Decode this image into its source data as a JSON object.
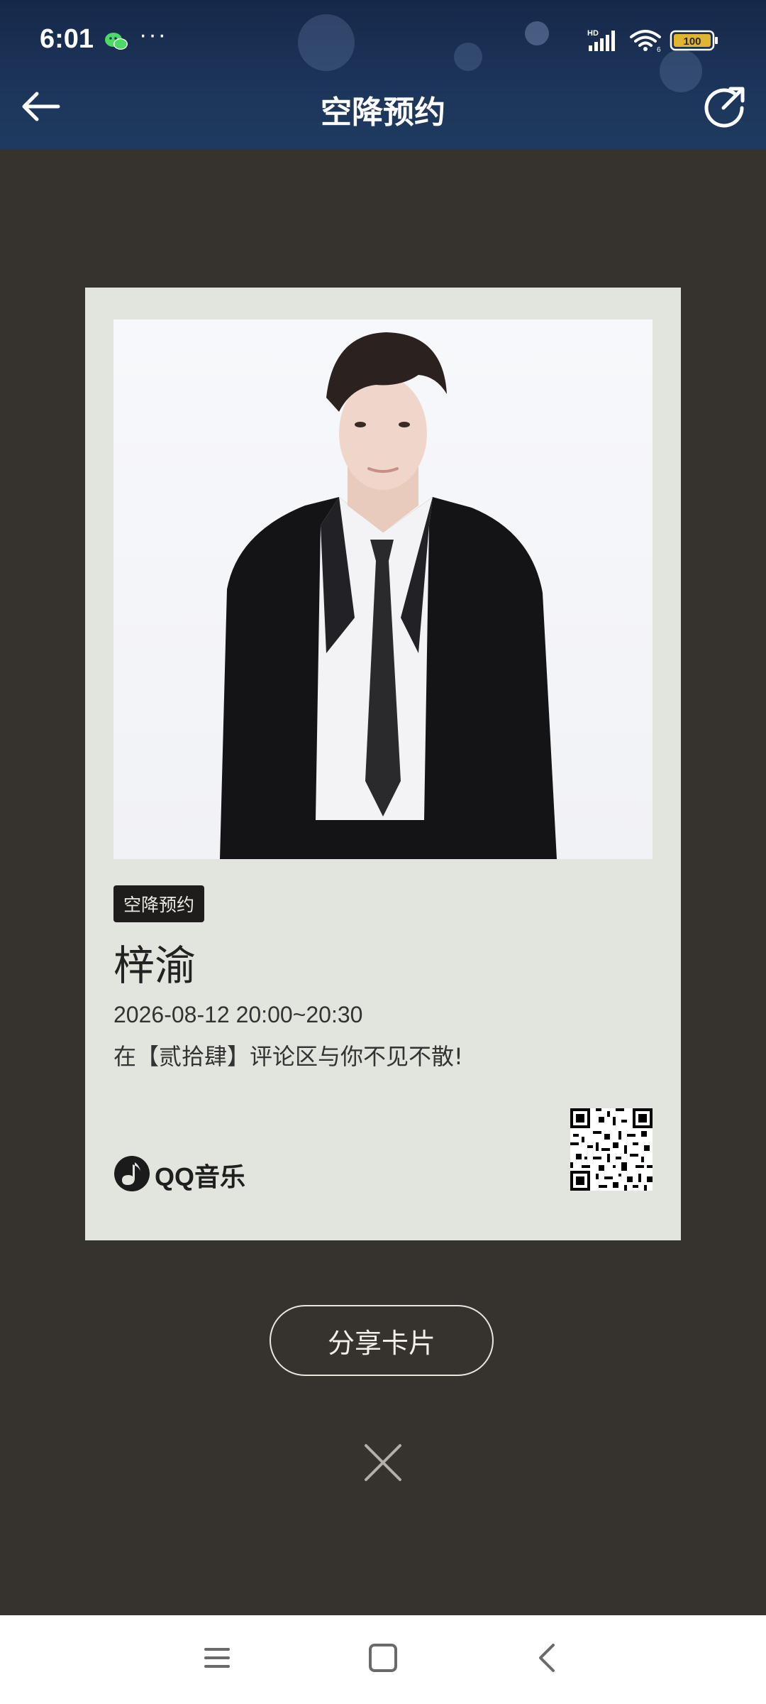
{
  "status_bar": {
    "time": "6:01",
    "more_dots": "···",
    "network_label": "HD",
    "wifi_label": "6",
    "battery": "100"
  },
  "header": {
    "title": "空降预约"
  },
  "card": {
    "tag": "空降预约",
    "artist": "梓渝",
    "datetime": "2026-08-12 20:00~20:30",
    "message": "在【贰拾肆】评论区与你不见不散!",
    "brand": "QQ音乐"
  },
  "actions": {
    "share_label": "分享卡片"
  },
  "colors": {
    "header_bg": "#1d355a",
    "page_bg": "#36322d",
    "card_bg": "#e2e5dd",
    "tag_bg": "#1e1d1b"
  },
  "icons": {
    "back": "arrow-left-icon",
    "share": "share-arrow-icon",
    "close": "close-icon",
    "nav_menu": "menu-lines-icon",
    "nav_home": "square-home-icon",
    "nav_back": "chevron-left-icon"
  }
}
